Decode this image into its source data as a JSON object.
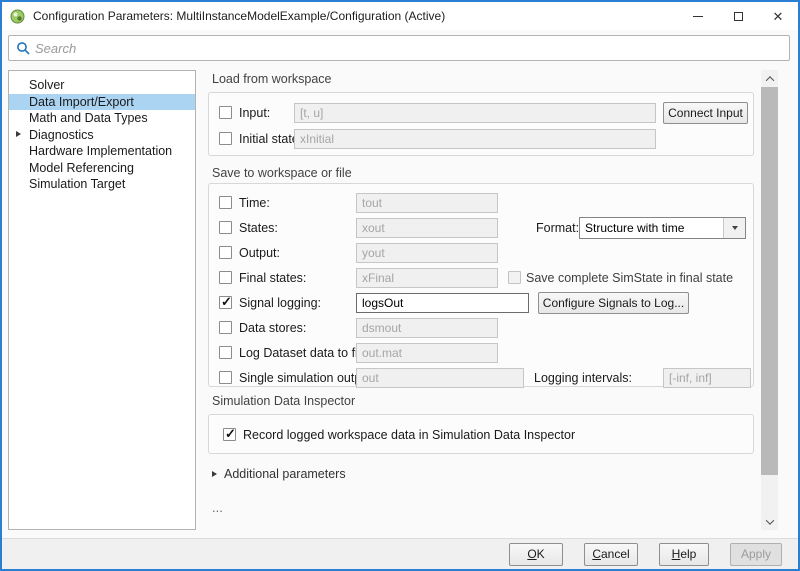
{
  "window": {
    "title": "Configuration Parameters: MultiInstanceModelExample/Configuration (Active)"
  },
  "search": {
    "placeholder": "Search"
  },
  "sidebar": {
    "items": [
      {
        "label": "Solver",
        "selected": false
      },
      {
        "label": "Data Import/Export",
        "selected": true
      },
      {
        "label": "Math and Data Types",
        "selected": false
      },
      {
        "label": "Diagnostics",
        "selected": false,
        "expandable": true
      },
      {
        "label": "Hardware Implementation",
        "selected": false
      },
      {
        "label": "Model Referencing",
        "selected": false
      },
      {
        "label": "Simulation Target",
        "selected": false
      }
    ]
  },
  "load_section": {
    "heading": "Load from workspace",
    "input_row": {
      "label": "Input:",
      "checked": false,
      "value": "[t, u]",
      "button": "Connect Input"
    },
    "initial_state_row": {
      "label": "Initial state:",
      "checked": false,
      "value": "xInitial"
    }
  },
  "save_section": {
    "heading": "Save to workspace or file",
    "rows": [
      {
        "label": "Time:",
        "checked": false,
        "value": "tout"
      },
      {
        "label": "States:",
        "checked": false,
        "value": "xout"
      },
      {
        "label": "Output:",
        "checked": false,
        "value": "yout"
      },
      {
        "label": "Final states:",
        "checked": false,
        "value": "xFinal"
      },
      {
        "label": "Signal logging:",
        "checked": true,
        "value": "logsOut"
      },
      {
        "label": "Data stores:",
        "checked": false,
        "value": "dsmout"
      },
      {
        "label": "Log Dataset data to file:",
        "checked": false,
        "value": "out.mat"
      },
      {
        "label": "Single simulation output:",
        "checked": false,
        "value": "out"
      }
    ],
    "format": {
      "label": "Format:",
      "value": "Structure with time"
    },
    "simstate": {
      "label": "Save complete SimState in final state",
      "checked": false
    },
    "configure_button": "Configure Signals to Log...",
    "logging_intervals": {
      "label": "Logging intervals:",
      "value": "[-inf, inf]"
    }
  },
  "sdi_section": {
    "heading": "Simulation Data Inspector",
    "record_row": {
      "label": "Record logged workspace data in Simulation Data Inspector",
      "checked": true
    }
  },
  "additional_parameters_label": "Additional parameters",
  "overflow_ellipsis": "...",
  "footer": {
    "buttons": [
      {
        "label": "OK"
      },
      {
        "label": "Cancel"
      },
      {
        "label": "Help"
      },
      {
        "label": "Apply",
        "disabled": true
      }
    ]
  },
  "colors": {
    "window_border": "#2a7fd4",
    "sidebar_selection": "#abd4f2",
    "search_icon": "#2176bd",
    "disabled_field_bg": "#f0f0f0",
    "disabled_text": "#a5a5a5"
  }
}
